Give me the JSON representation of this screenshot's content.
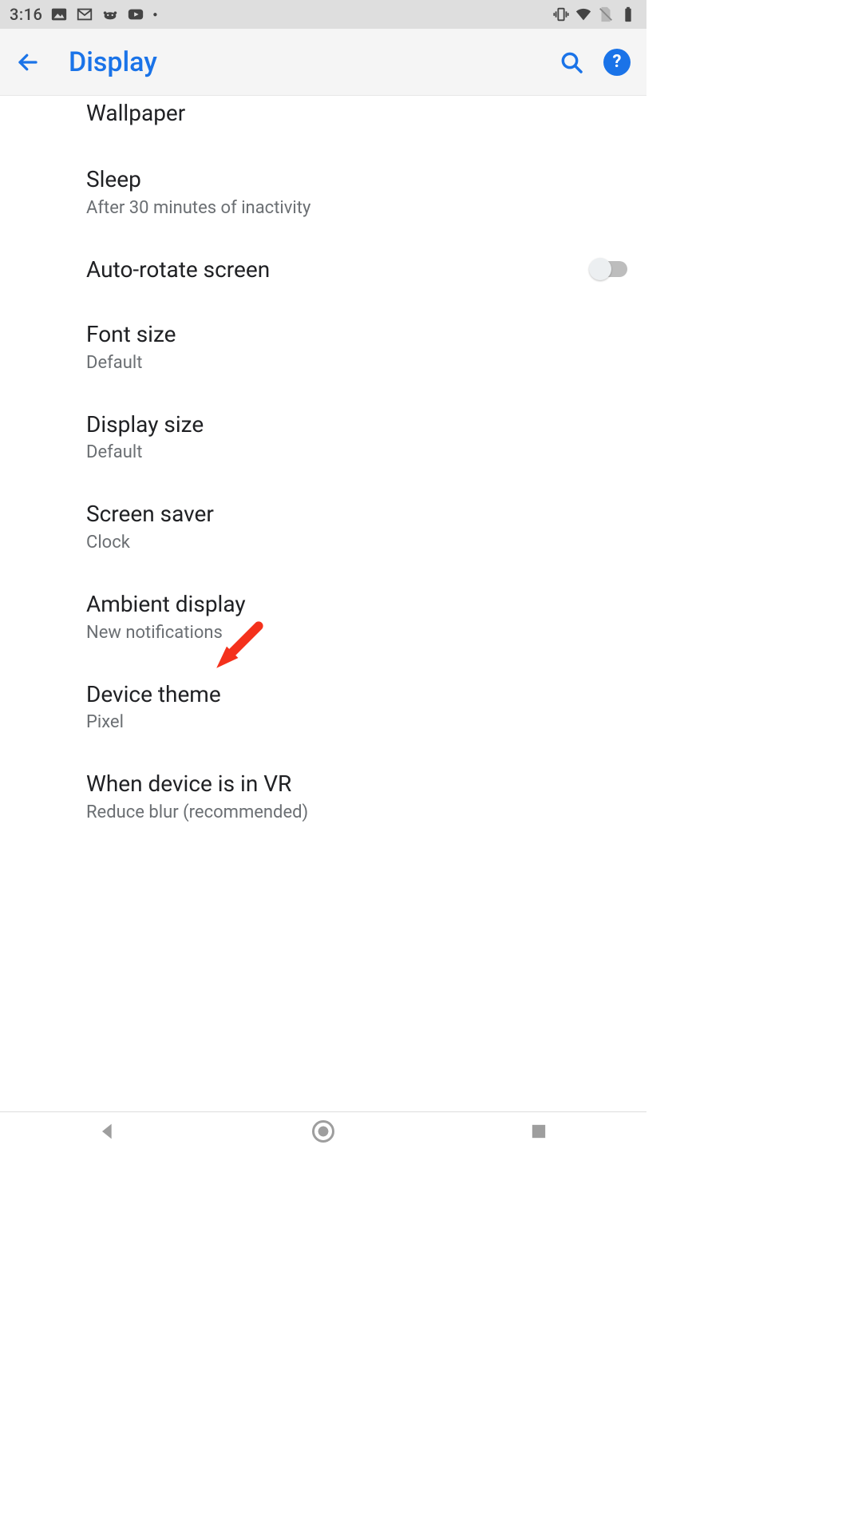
{
  "status": {
    "time": "3:16"
  },
  "appbar": {
    "title": "Display"
  },
  "items": [
    {
      "title": "Wallpaper",
      "sub": ""
    },
    {
      "title": "Sleep",
      "sub": "After 30 minutes of inactivity"
    },
    {
      "title": "Auto-rotate screen",
      "sub": "",
      "toggle": false
    },
    {
      "title": "Font size",
      "sub": "Default"
    },
    {
      "title": "Display size",
      "sub": "Default"
    },
    {
      "title": "Screen saver",
      "sub": "Clock"
    },
    {
      "title": "Ambient display",
      "sub": "New notifications"
    },
    {
      "title": "Device theme",
      "sub": "Pixel"
    },
    {
      "title": "When device is in VR",
      "sub": "Reduce blur (recommended)"
    }
  ]
}
